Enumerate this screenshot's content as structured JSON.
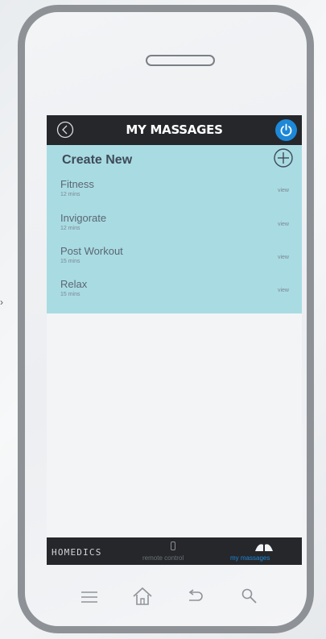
{
  "screen": {
    "title": "MY MASSAGES",
    "back_icon": "back-circle-icon",
    "power_icon": "power-icon"
  },
  "list": {
    "create_label": "Create New",
    "add_icon": "plus-circle-icon",
    "items": [
      {
        "name": "Fitness",
        "duration": "12 mins",
        "action": "view"
      },
      {
        "name": "Invigorate",
        "duration": "12 mins",
        "action": "view"
      },
      {
        "name": "Post Workout",
        "duration": "15 mins",
        "action": "view"
      },
      {
        "name": "Relax",
        "duration": "15 mins",
        "action": "view"
      }
    ]
  },
  "tabbar": {
    "brand": "HOMEDICS",
    "tabs": [
      {
        "label": "remote control",
        "icon": "remote-icon",
        "active": false
      },
      {
        "label": "my massages",
        "icon": "massage-icon",
        "active": true
      }
    ]
  },
  "phone_nav": {
    "icons": [
      "menu-icon",
      "home-icon",
      "back-arrow-icon",
      "search-icon"
    ]
  },
  "colors": {
    "accent": "#1e88d8",
    "list_bg": "#a9dbe3",
    "bar_bg": "#25272b"
  }
}
